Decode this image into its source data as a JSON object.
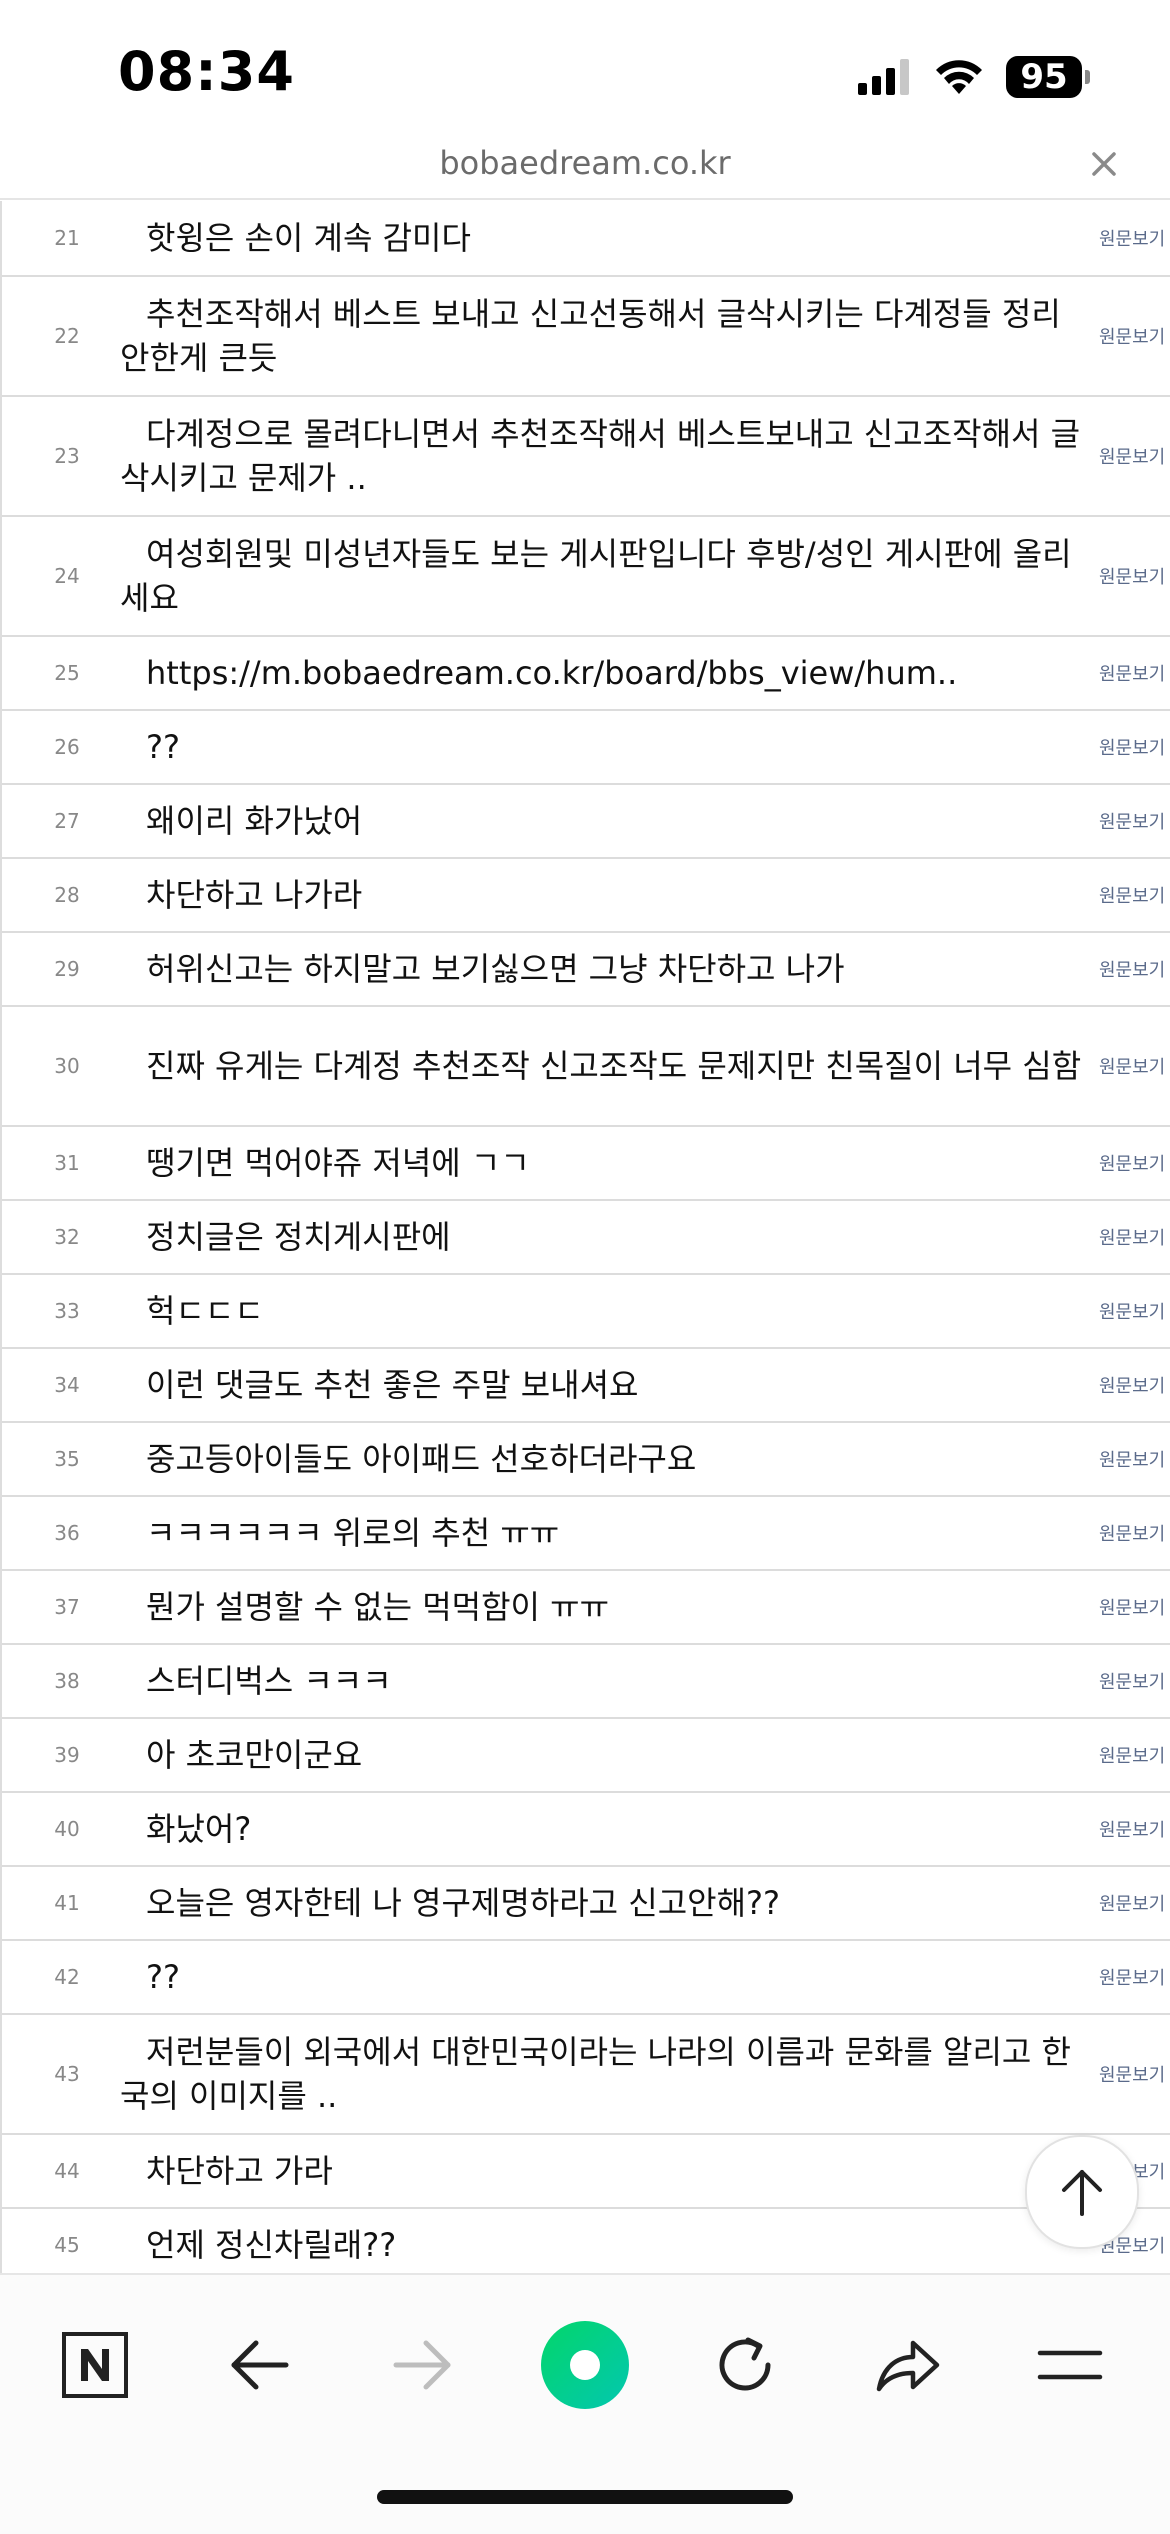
{
  "status_bar": {
    "time": "08:34",
    "battery": "95",
    "icons": [
      "cellular-signal-icon",
      "wifi-icon",
      "battery-icon"
    ]
  },
  "url_bar": {
    "domain": "bobaedream.co.kr",
    "close_icon": "close-icon"
  },
  "comments": [
    {
      "num": "21",
      "text": "핫윙은 손이 계속 감미다",
      "link": "원문보기"
    },
    {
      "num": "22",
      "text": "추천조작해서 베스트 보내고 신고선동해서 글삭시키는 다계정들 정리 안한게 큰듯",
      "link": "원문보기"
    },
    {
      "num": "23",
      "text": "다계정으로 몰려다니면서 추천조작해서 베스트보내고 신고조작해서 글삭시키고 문제가 ..",
      "link": "원문보기"
    },
    {
      "num": "24",
      "text": "여성회원및 미성년자들도 보는 게시판입니다 후방/성인 게시판에 올리세요",
      "link": "원문보기"
    },
    {
      "num": "25",
      "text": "https://m.bobaedream.co.kr/board/bbs_view/hum..",
      "link": "원문보기"
    },
    {
      "num": "26",
      "text": "??",
      "link": "원문보기"
    },
    {
      "num": "27",
      "text": "왜이리 화가났어",
      "link": "원문보기"
    },
    {
      "num": "28",
      "text": "차단하고 나가라",
      "link": "원문보기"
    },
    {
      "num": "29",
      "text": "허위신고는 하지말고 보기싫으면 그냥 차단하고 나가",
      "link": "원문보기"
    },
    {
      "num": "30",
      "text": "진짜 유게는 다계정 추천조작 신고조작도 문제지만 친목질이 너무 심함",
      "link": "원문보기"
    },
    {
      "num": "31",
      "text": "땡기면 먹어야쥬 저녁에 ㄱㄱ",
      "link": "원문보기"
    },
    {
      "num": "32",
      "text": "정치글은 정치게시판에",
      "link": "원문보기"
    },
    {
      "num": "33",
      "text": "헉ㄷㄷㄷ",
      "link": "원문보기"
    },
    {
      "num": "34",
      "text": "이런 댓글도 추천 좋은 주말 보내셔요",
      "link": "원문보기"
    },
    {
      "num": "35",
      "text": "중고등아이들도 아이패드 선호하더라구요",
      "link": "원문보기"
    },
    {
      "num": "36",
      "text": "ㅋㅋㅋㅋㅋㅋ 위로의 추천 ㅠㅠ",
      "link": "원문보기"
    },
    {
      "num": "37",
      "text": "뭔가 설명할 수 없는 먹먹함이 ㅠㅠ",
      "link": "원문보기"
    },
    {
      "num": "38",
      "text": "스터디벅스 ㅋㅋㅋ",
      "link": "원문보기"
    },
    {
      "num": "39",
      "text": "아 초코만이군요",
      "link": "원문보기"
    },
    {
      "num": "40",
      "text": "화났어?",
      "link": "원문보기"
    },
    {
      "num": "41",
      "text": "오늘은 영자한테 나 영구제명하라고 신고안해??",
      "link": "원문보기"
    },
    {
      "num": "42",
      "text": "??",
      "link": "원문보기"
    },
    {
      "num": "43",
      "text": "저런분들이 외국에서 대한민국이라는 나라의 이름과 문화를 알리고 한국의 이미지를 ..",
      "link": "원문보기"
    },
    {
      "num": "44",
      "text": "차단하고 가라",
      "link": "원문보기"
    },
    {
      "num": "45",
      "text": "언제 정신차릴래??",
      "link": "원문보기"
    }
  ],
  "scroll_top_icon": "arrow-up-icon",
  "toolbar": {
    "buttons": [
      {
        "icon": "naver-n-icon",
        "label": "N"
      },
      {
        "icon": "back-arrow-icon"
      },
      {
        "icon": "forward-arrow-icon",
        "disabled": true
      },
      {
        "icon": "green-circle-icon"
      },
      {
        "icon": "reload-icon"
      },
      {
        "icon": "share-icon"
      },
      {
        "icon": "menu-icon"
      }
    ],
    "accent": "#03c75a"
  }
}
